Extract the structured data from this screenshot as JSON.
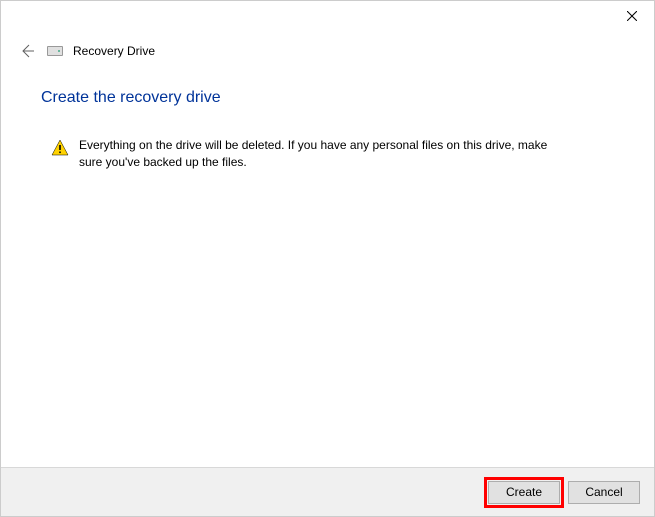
{
  "header": {
    "title": "Recovery Drive"
  },
  "main": {
    "heading": "Create the recovery drive",
    "warning_text": "Everything on the drive will be deleted. If you have any personal files on this drive, make sure you've backed up the files."
  },
  "footer": {
    "create_label": "Create",
    "cancel_label": "Cancel"
  }
}
